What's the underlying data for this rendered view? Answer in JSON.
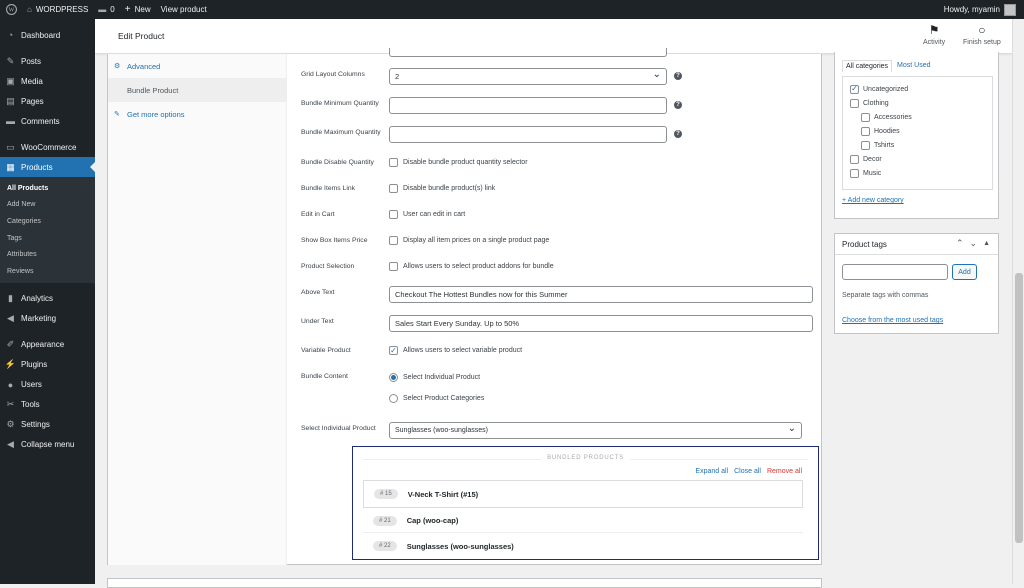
{
  "adminbar": {
    "site_name": "WORDPRESS",
    "comments_count": "0",
    "new_label": "New",
    "view_product": "View product",
    "howdy": "Howdy, myamin"
  },
  "sidebar": {
    "items": [
      {
        "label": "Dashboard",
        "icon": "dashboard-icon"
      },
      {
        "label": "Posts",
        "icon": "pin-icon"
      },
      {
        "label": "Media",
        "icon": "media-icon"
      },
      {
        "label": "Pages",
        "icon": "pages-icon"
      },
      {
        "label": "Comments",
        "icon": "comment-icon"
      },
      {
        "label": "WooCommerce",
        "icon": "woo-icon"
      },
      {
        "label": "Products",
        "icon": "products-icon"
      },
      {
        "label": "Analytics",
        "icon": "chart-icon"
      },
      {
        "label": "Marketing",
        "icon": "megaphone-icon"
      },
      {
        "label": "Appearance",
        "icon": "brush-icon"
      },
      {
        "label": "Plugins",
        "icon": "plug-icon"
      },
      {
        "label": "Users",
        "icon": "users-icon"
      },
      {
        "label": "Tools",
        "icon": "wrench-icon"
      },
      {
        "label": "Settings",
        "icon": "settings-icon"
      },
      {
        "label": "Collapse menu",
        "icon": "collapse-icon"
      }
    ],
    "submenu": [
      "All Products",
      "Add New",
      "Categories",
      "Tags",
      "Attributes",
      "Reviews"
    ]
  },
  "header": {
    "title": "Edit Product",
    "activity": "Activity",
    "finish_setup": "Finish setup"
  },
  "tabs": [
    {
      "label": "Advanced",
      "icon": "gear-icon"
    },
    {
      "label": "Bundle Product",
      "icon": "bundle-icon"
    },
    {
      "label": "Get more options",
      "icon": "plug-icon"
    }
  ],
  "fields": {
    "grid_layout_label": "Grid Layout Columns",
    "grid_layout_value": "2",
    "min_qty_label": "Bundle Minimum Quantity",
    "min_qty_value": "",
    "max_qty_label": "Bundle Maximum Quantity",
    "max_qty_value": "",
    "disable_qty_label": "Bundle Disable Quantity",
    "disable_qty_text": "Disable bundle product quantity selector",
    "items_link_label": "Bundle Items Link",
    "items_link_text": "Disable bundle product(s) link",
    "edit_cart_label": "Edit in Cart",
    "edit_cart_text": "User can edit in cart",
    "show_prices_label": "Show Box Items Price",
    "show_prices_text": "Display all item prices on a single product page",
    "product_selection_label": "Product Selection",
    "product_selection_text": "Allows users to select product addons for bundle",
    "above_text_label": "Above Text",
    "above_text_value": "Checkout The Hottest Bundles now for this Summer",
    "under_text_label": "Under Text",
    "under_text_value": "Sales Start Every Sunday. Up to 50%",
    "variable_label": "Variable Product",
    "variable_text": "Allows users to select variable product",
    "bundle_content_label": "Bundle Content",
    "radio_individual": "Select Individual Product",
    "radio_categories": "Select Product Categories",
    "select_individual_label": "Select Individual Product",
    "select_individual_value": "Sunglasses (woo-sunglasses)",
    "help": "?"
  },
  "bundle": {
    "heading": "BUNDLED PRODUCTS",
    "expand_all": "Expand all",
    "close_all": "Close all",
    "remove_all": "Remove all",
    "items": [
      {
        "id": "# 15",
        "name": "V-Neck T-Shirt (#15)"
      },
      {
        "id": "# 21",
        "name": "Cap (woo-cap)"
      },
      {
        "id": "# 22",
        "name": "Sunglasses (woo-sunglasses)"
      }
    ]
  },
  "categories": {
    "tab_all": "All categories",
    "tab_most_used": "Most Used",
    "items": [
      "Uncategorized",
      "Clothing",
      "Accessories",
      "Hoodies",
      "Tshirts",
      "Decor",
      "Music"
    ],
    "add_new": "+ Add new category"
  },
  "tags": {
    "title": "Product tags",
    "add_button": "Add",
    "hint": "Separate tags with commas",
    "choose_link": "Choose from the most used tags"
  },
  "colors": {
    "accent": "#2271b1",
    "bundle_border": "#1e2a78",
    "remove": "#d63638"
  }
}
